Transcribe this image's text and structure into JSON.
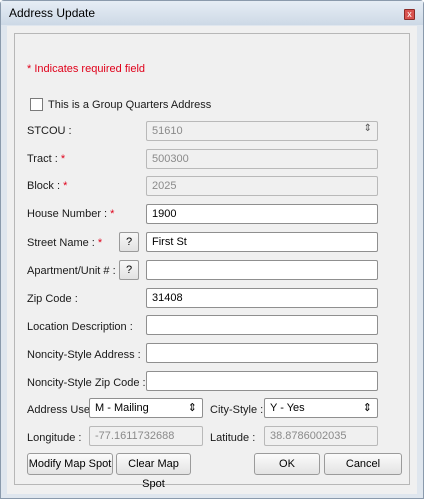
{
  "window": {
    "title": "Address Update",
    "close_symbol": "x"
  },
  "form": {
    "required_note": "* Indicates required field",
    "group_quarters_label": "This is a Group Quarters Address",
    "group_quarters_checked": false,
    "stcou": {
      "label": "STCOU :",
      "value": "51610"
    },
    "tract": {
      "label": "Tract :",
      "required_mark": "*",
      "value": "500300"
    },
    "block": {
      "label": "Block :",
      "required_mark": "*",
      "value": "2025"
    },
    "house_number": {
      "label": "House Number :",
      "required_mark": "*",
      "value": "1900"
    },
    "street_name": {
      "label": "Street Name :",
      "required_mark": "*",
      "help": "?",
      "value": "First St"
    },
    "apartment": {
      "label": "Apartment/Unit # :",
      "help": "?",
      "value": ""
    },
    "zip_code": {
      "label": "Zip Code :",
      "value": "31408"
    },
    "location_description": {
      "label": "Location Description :",
      "value": ""
    },
    "noncity_address": {
      "label": "Noncity-Style Address :",
      "value": ""
    },
    "noncity_zip": {
      "label": "Noncity-Style Zip Code :",
      "value": ""
    },
    "address_use": {
      "label": "Address Use:",
      "value": "M - Mailing"
    },
    "city_style": {
      "label": "City-Style :",
      "value": "Y - Yes"
    },
    "longitude": {
      "label": "Longitude :",
      "value": "-77.1611732688"
    },
    "latitude": {
      "label": "Latitude :",
      "value": "38.8786002035"
    }
  },
  "buttons": {
    "modify_map_spot": "Modify Map Spot",
    "clear_map_spot": "Clear Map Spot",
    "ok": "OK",
    "cancel": "Cancel"
  }
}
